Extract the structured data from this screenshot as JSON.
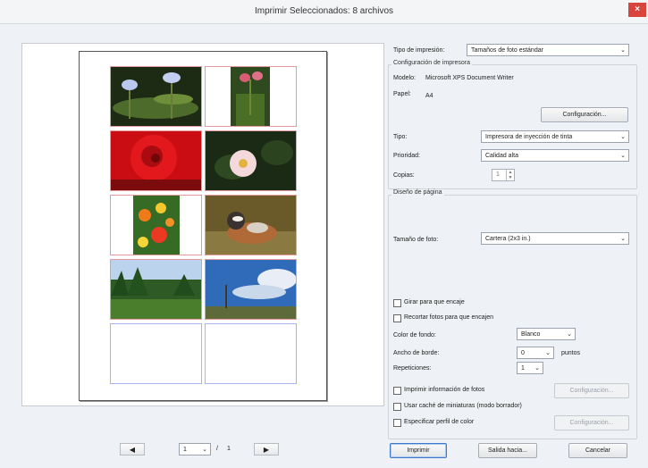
{
  "window": {
    "title": "Imprimir  Seleccionados: 8 archivos",
    "close": "×"
  },
  "print_type": {
    "label": "Tipo de impresión:",
    "value": "Tamaños de foto estándar"
  },
  "printer_config": {
    "title": "Configuración de impresora",
    "model_label": "Modelo:",
    "model_value": "Microsoft XPS Document Writer",
    "paper_label": "Papel:",
    "paper_value": "A4",
    "config_button": "Configuración...",
    "type_label": "Tipo:",
    "type_value": "Impresora de inyección de tinta",
    "priority_label": "Prioridad:",
    "priority_value": "Calidad alta",
    "copies_label": "Copias:",
    "copies_value": "1"
  },
  "page_design": {
    "title": "Diseño de página",
    "photo_size_label": "Tamaño de foto:",
    "photo_size_value": "Cartera (2x3 in.)",
    "rotate_fit": "Girar para que encaje",
    "crop_fit": "Recortar fotos para que encajen",
    "bg_color_label": "Color de fondo:",
    "bg_color_value": "Blanco",
    "border_width_label": "Ancho de borde:",
    "border_width_value": "0",
    "border_units": "puntos",
    "repetitions_label": "Repeticiones:",
    "repetitions_value": "1",
    "print_info": "Imprimir información de fotos",
    "print_info_config": "Configuración...",
    "thumb_cache": "Usar caché de miniaturas (modo borrador)",
    "color_profile": "Especificar perfil de color",
    "color_profile_config": "Configuración..."
  },
  "pager": {
    "prev": "◀",
    "page": "1",
    "separator": "/",
    "total": "1",
    "next": "▶"
  },
  "buttons": {
    "print": "Imprimir",
    "save_as": "Salida hacia...",
    "cancel": "Cancelar"
  },
  "chevron": "⌄"
}
